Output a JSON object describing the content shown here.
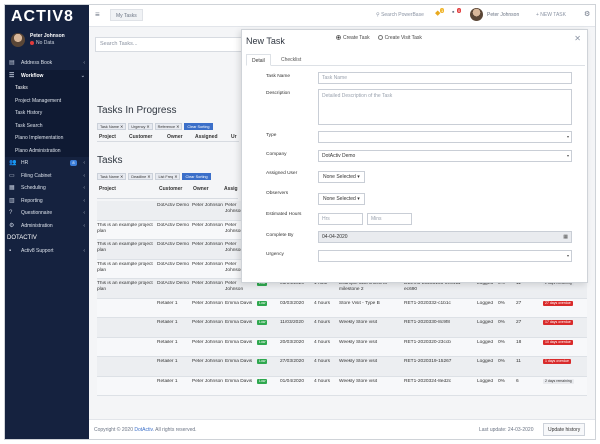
{
  "app": {
    "logo": "ACTIV8"
  },
  "user": {
    "name": "Peter Johnson",
    "status": "No Data"
  },
  "sidebar": {
    "items": [
      {
        "label": "Address Book",
        "icon": "address-book-icon"
      },
      {
        "label": "Workflow",
        "icon": "workflow-icon",
        "open": true
      }
    ],
    "workflow_sub": [
      "Tasks",
      "Project Management",
      "Task History",
      "Task Search",
      "Plano Implementation",
      "Plano Administration"
    ],
    "items_after": [
      {
        "label": "HR",
        "icon": "people-icon",
        "badge": "8"
      },
      {
        "label": "Filing Cabinet",
        "icon": "folder-icon"
      },
      {
        "label": "Scheduling",
        "icon": "calendar-icon"
      },
      {
        "label": "Reporting",
        "icon": "chart-icon"
      },
      {
        "label": "Questionnaire",
        "icon": "question-icon"
      },
      {
        "label": "Administration",
        "icon": "gear-icon"
      }
    ],
    "section": "DOTACTIV",
    "support": "Activ8 Support"
  },
  "topbar": {
    "tab": "My Tasks",
    "search": "Search PowerBase",
    "bell_count": "1",
    "flag_count": "0",
    "user": "Peter Johnson",
    "new_task": "+ NEW TASK"
  },
  "main": {
    "search_placeholder": "Search Tasks...",
    "in_progress_title": "Tasks In Progress",
    "in_progress_chips": [
      "Task Name ✕",
      "Urgency ✕",
      "Reference ✕",
      "Clear Sorting"
    ],
    "in_progress_headers": [
      "Project",
      "Customer",
      "Owner",
      "Assigned",
      "Ur"
    ],
    "tasks_title": "Tasks",
    "tasks_chips": [
      "Task Name ✕",
      "Deadline ✕",
      "List Freq ✕",
      "Clear Sorting"
    ],
    "tasks_headers": [
      "Project",
      "Customer",
      "Owner",
      "Assig"
    ],
    "rows": [
      {
        "project": "",
        "customer": "DotActiv Demo",
        "owner": "Peter Johnson",
        "assigned": "Peter Johnson",
        "low": "",
        "date": "",
        "hours": "",
        "name": "",
        "ref": "",
        "status": "",
        "pct": "",
        "num": "",
        "remain": "",
        "over": false
      },
      {
        "project": "This is an example project plan",
        "customer": "DotActiv Demo",
        "owner": "Peter Johnson",
        "assigned": "Peter Johnson",
        "low": "",
        "date": "",
        "hours": "",
        "name": "",
        "ref": "",
        "status": "",
        "pct": "",
        "num": "",
        "remain": "",
        "over": false
      },
      {
        "project": "This is an example project plan",
        "customer": "DotActiv Demo",
        "owner": "Peter Johnson",
        "assigned": "Peter Johnson",
        "low": "",
        "date": "",
        "hours": "",
        "name": "",
        "ref": "",
        "status": "",
        "pct": "",
        "num": "",
        "remain": "",
        "over": false
      },
      {
        "project": "This is an example project plan",
        "customer": "DotActiv Demo",
        "owner": "Peter Johnson",
        "assigned": "Peter Johnson",
        "low": "",
        "date": "",
        "hours": "",
        "name": "",
        "ref": "",
        "status": "",
        "pct": "",
        "num": "",
        "remain": "",
        "over": false
      },
      {
        "project": "This is an example project plan",
        "customer": "DotActiv Demo",
        "owner": "Peter Johnson",
        "assigned": "Peter Johnson",
        "low": "Low",
        "date": "01/04/2020",
        "hours": "1 hour",
        "name": "Example task linked to milestone 2",
        "ref": "DDemo-20203193-0e0411-ec690",
        "status": "Logged",
        "pct": "0%",
        "num": "11",
        "remain": "2 days remaining",
        "over": false
      },
      {
        "project": "",
        "customer": "Retailer 1",
        "owner": "Peter Johnson",
        "assigned": "Emma Davis",
        "low": "Low",
        "date": "03/03/2020",
        "hours": "4 hours",
        "name": "Store Visit - Type B",
        "ref": "RET1-2020332-c1b1c",
        "status": "Logged",
        "pct": "0%",
        "num": "27",
        "remain": "27 days overdue",
        "over": true
      },
      {
        "project": "",
        "customer": "Retailer 1",
        "owner": "Peter Johnson",
        "assigned": "Emma Davis",
        "low": "Low",
        "date": "11/03/2020",
        "hours": "4 hours",
        "name": "Weekly Store visit",
        "ref": "RET1-2020330-8c9f8",
        "status": "Logged",
        "pct": "0%",
        "num": "27",
        "remain": "17 days overdue",
        "over": true
      },
      {
        "project": "",
        "customer": "Retailer 1",
        "owner": "Peter Johnson",
        "assigned": "Emma Davis",
        "low": "Low",
        "date": "20/03/2020",
        "hours": "4 hours",
        "name": "Weekly Store visit",
        "ref": "RET1-2020320-23ccb",
        "status": "Logged",
        "pct": "0%",
        "num": "18",
        "remain": "10 days overdue",
        "over": true
      },
      {
        "project": "",
        "customer": "Retailer 1",
        "owner": "Peter Johnson",
        "assigned": "Emma Davis",
        "low": "Low",
        "date": "27/03/2020",
        "hours": "4 hours",
        "name": "Weekly Store visit",
        "ref": "RET1-2020319-15267",
        "status": "Logged",
        "pct": "0%",
        "num": "11",
        "remain": "1 days overdue",
        "over": true
      },
      {
        "project": "",
        "customer": "Retailer 1",
        "owner": "Peter Johnson",
        "assigned": "Emma Davis",
        "low": "Low",
        "date": "01/04/2020",
        "hours": "4 hours",
        "name": "Weekly Store visit",
        "ref": "RET1-2020324-8ed2c",
        "status": "Logged",
        "pct": "0%",
        "num": "6",
        "remain": "2 days remaining",
        "over": false
      }
    ]
  },
  "footer": {
    "copyright_prefix": "Copyright © 2020",
    "copyright_link": "DotActiv.",
    "copyright_suffix": "All rights reserved.",
    "last_update": "Last update: 24-03-2020",
    "update_history": "Update history"
  },
  "panel": {
    "title": "New Task",
    "radio_create": "Create Task",
    "radio_visit": "Create Visit Task",
    "tabs": [
      "Detail",
      "Checklist"
    ],
    "fields": {
      "task_name_label": "Task Name",
      "task_name_placeholder": "Task Name",
      "description_label": "Description",
      "description_placeholder": "Detailed Description of the Task",
      "type_label": "Type",
      "company_label": "Company",
      "company_value": "DotActiv Demo",
      "assigned_label": "Assigned User",
      "assigned_value": "None Selected",
      "observers_label": "Observers",
      "observers_value": "None Selected",
      "hours_label": "Estimated Hours",
      "hrs_placeholder": "Hrs",
      "mins_placeholder": "Mins",
      "complete_label": "Complete By",
      "complete_value": "04-04-2020",
      "urgency_label": "Urgency"
    }
  },
  "colors": {
    "sidebar": "#15223f",
    "accent": "#3b6fc9",
    "low": "#2fa84f",
    "overdue": "#d92b2b"
  }
}
